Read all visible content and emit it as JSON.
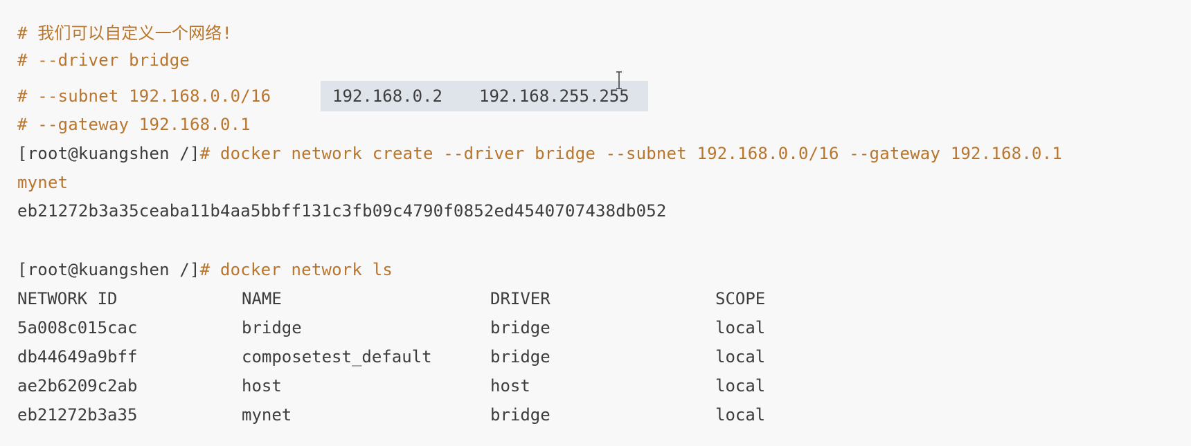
{
  "terminal": {
    "comments": [
      "# 我们可以自定义一个网络!",
      "# --driver bridge",
      "# --subnet 192.168.0.0/16",
      "# --gateway 192.168.0.1"
    ],
    "highlight": {
      "start": "192.168.0.2",
      "end": "192.168.255.255"
    },
    "create": {
      "prompt": "[root@kuangshen /]",
      "hash": "#",
      "command": " docker network create --driver bridge --subnet 192.168.0.0/16 --gateway 192.168.0.1",
      "command_cont": "mynet",
      "output": "eb21272b3a35ceaba11b4aa5bbff131c3fb09c4790f0852ed4540707438db052"
    },
    "ls": {
      "prompt": "[root@kuangshen /]",
      "hash": "#",
      "command": " docker network ls",
      "headers": [
        "NETWORK ID",
        "NAME",
        "DRIVER",
        "SCOPE"
      ],
      "rows": [
        [
          "5a008c015cac",
          "bridge",
          "bridge",
          "local"
        ],
        [
          "db44649a9bff",
          "composetest_default",
          "bridge",
          "local"
        ],
        [
          "ae2b6209c2ab",
          "host",
          "host",
          "local"
        ],
        [
          "eb21272b3a35",
          "mynet",
          "bridge",
          "local"
        ]
      ]
    }
  }
}
